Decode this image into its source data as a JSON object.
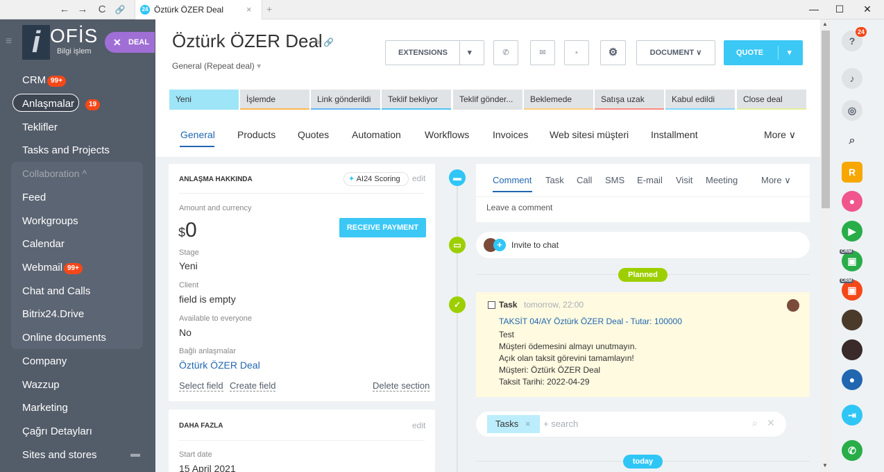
{
  "browser": {
    "tab_title": "Öztürk ÖZER Deal",
    "tab_badge": "24",
    "back": "←",
    "forward": "→",
    "reload": "C",
    "link": "🔗",
    "close_tab": "×",
    "new_tab": "+",
    "minimize": "—",
    "maximize": "☐",
    "close": "✕"
  },
  "sidebar": {
    "logo_text": "OFİS",
    "logo_sub": "Bilgi işlem",
    "deal_pill": "DEAL",
    "items": [
      {
        "label": "CRM",
        "badge": "99+"
      },
      {
        "label": "Anlaşmalar",
        "badge": "19"
      },
      {
        "label": "Teklifler"
      },
      {
        "label": "Tasks and Projects"
      },
      {
        "label": "Collaboration ^"
      },
      {
        "label": "Feed"
      },
      {
        "label": "Workgroups"
      },
      {
        "label": "Calendar"
      },
      {
        "label": "Webmail",
        "badge": "99+"
      },
      {
        "label": "Chat and Calls"
      },
      {
        "label": "Bitrix24.Drive"
      },
      {
        "label": "Online documents"
      },
      {
        "label": "Company"
      },
      {
        "label": "Wazzup"
      },
      {
        "label": "Marketing"
      },
      {
        "label": "Çağrı Detayları"
      },
      {
        "label": "Sites and stores"
      }
    ]
  },
  "header": {
    "title": "Öztürk ÖZER  Deal",
    "subtitle": "General (Repeat deal)",
    "extensions": "EXTENSIONS",
    "document": "DOCUMENT",
    "quote": "QUOTE"
  },
  "stages": [
    "Yeni",
    "İşlemde",
    "Link gönderildi",
    "Teklif bekliyor",
    "Teklif gönder...",
    "Beklemede",
    "Satışa uzak",
    "Kabul edildi",
    "Close deal"
  ],
  "tabs": [
    "General",
    "Products",
    "Quotes",
    "Automation",
    "Workflows",
    "Invoices",
    "Web sitesi müşteri",
    "Installment",
    "More"
  ],
  "about": {
    "heading": "ANLAŞMA HAKKINDA",
    "scoring": "AI24 Scoring",
    "edit": "edit",
    "amount_label": "Amount and currency",
    "currency": "$",
    "amount": "0",
    "receive_payment": "RECEIVE PAYMENT",
    "stage_label": "Stage",
    "stage_value": "Yeni",
    "client_label": "Client",
    "client_value": "field is empty",
    "available_label": "Available to everyone",
    "available_value": "No",
    "linked_label": "Bağlı anlaşmalar",
    "linked_value": "Öztürk ÖZER Deal",
    "select_field": "Select field",
    "create_field": "Create field",
    "delete_section": "Delete section"
  },
  "more_panel": {
    "heading": "DAHA FAZLA",
    "edit": "edit",
    "start_label": "Start date",
    "start_value": "15 April 2021"
  },
  "activity": {
    "tabs": [
      "Comment",
      "Task",
      "Call",
      "SMS",
      "E-mail",
      "Visit",
      "Meeting",
      "More"
    ],
    "placeholder": "Leave a comment",
    "invite": "Invite to chat",
    "planned": "Planned",
    "task_title": "Task",
    "task_time": "tomorrow, 22:00",
    "task_link": "TAKSİT 04/AY Öztürk ÖZER Deal - Tutar: 100000",
    "task_lines": [
      "Test",
      "Müşteri ödemesini almayı unutmayın.",
      "Açık olan taksit görevini tamamlayın!",
      "Müşteri: Öztürk ÖZER Deal",
      "Taksit Tarihi: 2022-04-29"
    ],
    "filter_tag": "Tasks",
    "search_placeholder": "+ search",
    "today": "today"
  },
  "rail": {
    "help_badge": "24",
    "crm_label": "CRM"
  }
}
